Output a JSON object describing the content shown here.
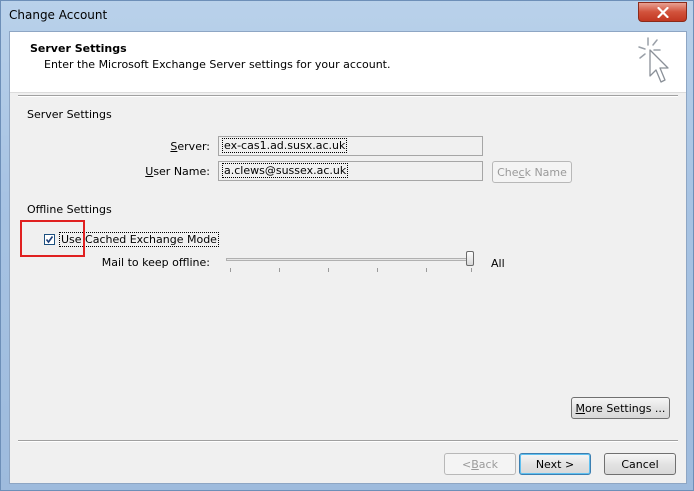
{
  "window": {
    "title": "Change Account",
    "close_icon": "close-icon"
  },
  "header": {
    "title": "Server Settings",
    "subtitle": "Enter the Microsoft Exchange Server settings for your account.",
    "icon": "cursor-sparkle-icon"
  },
  "server_settings": {
    "group_label": "Server Settings",
    "server_label_pre": "",
    "server_label_hot": "S",
    "server_label_post": "erver:",
    "server_value": "ex-cas1.ad.susx.ac.uk",
    "username_label_pre": "",
    "username_label_hot": "U",
    "username_label_post": "ser Name:",
    "username_value": "a.clews@sussex.ac.uk",
    "check_name_pre": "Che",
    "check_name_hot": "c",
    "check_name_post": "k Name",
    "check_name_enabled": false
  },
  "offline_settings": {
    "group_label": "Offline Settings",
    "cached_mode_label": "Use Cached Exchange Mode",
    "cached_mode_checked": true,
    "mail_keep_label": "Mail to keep offline:",
    "slider_value_label": "All",
    "slider_position": 1.0
  },
  "buttons": {
    "more_settings_pre": "",
    "more_settings_hot": "M",
    "more_settings_post": "ore Settings ...",
    "back_pre": "< ",
    "back_hot": "B",
    "back_post": "ack",
    "next": "Next >",
    "cancel": "Cancel"
  },
  "colors": {
    "highlight": "#e02020",
    "titlebar": "#b9d1ea",
    "close_button": "#c13822"
  }
}
